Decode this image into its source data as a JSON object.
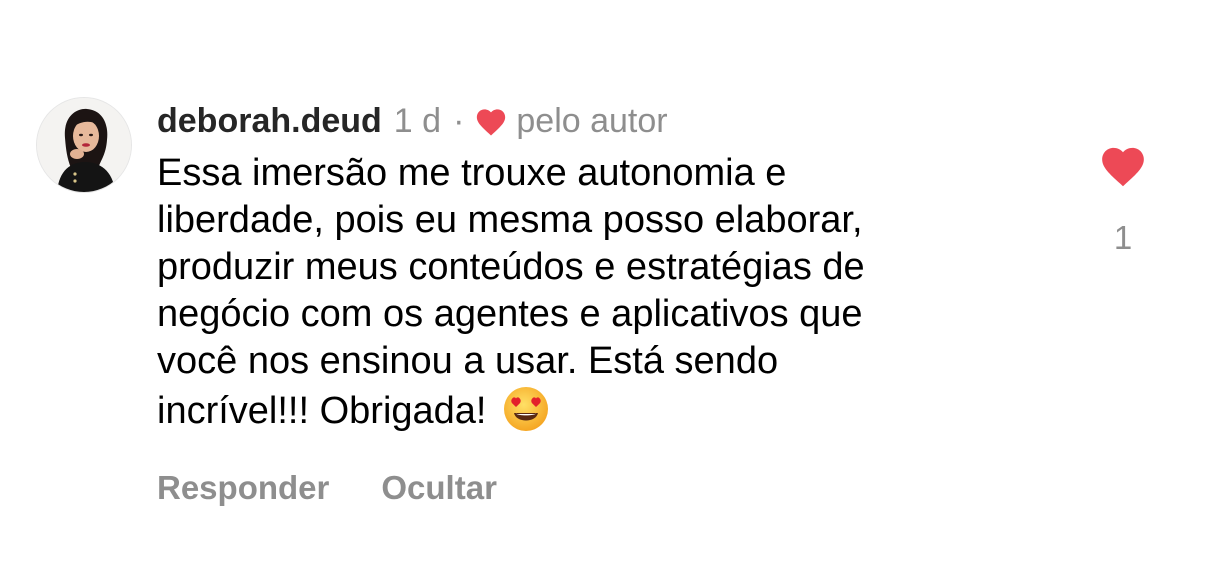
{
  "comment": {
    "username": "deborah.deud",
    "time": "1 d",
    "separator": "·",
    "author_like_label": "pelo autor",
    "text_lines": [
      "Essa imersão me trouxe autonomia e",
      "liberdade, pois eu mesma posso elaborar,",
      "produzir meus conteúdos e estratégias de",
      "negócio com os agentes e aplicativos que",
      "você nos ensinou a usar. Está sendo",
      "incrível!!! Obrigada!"
    ],
    "emoji": "smiling-face-with-heart-eyes",
    "likes_count": "1"
  },
  "actions": {
    "reply_label": "Responder",
    "hide_label": "Ocultar"
  },
  "colors": {
    "heart_red": "#ed4956",
    "secondary_text": "#8e8e8e",
    "username_text": "#262626"
  }
}
